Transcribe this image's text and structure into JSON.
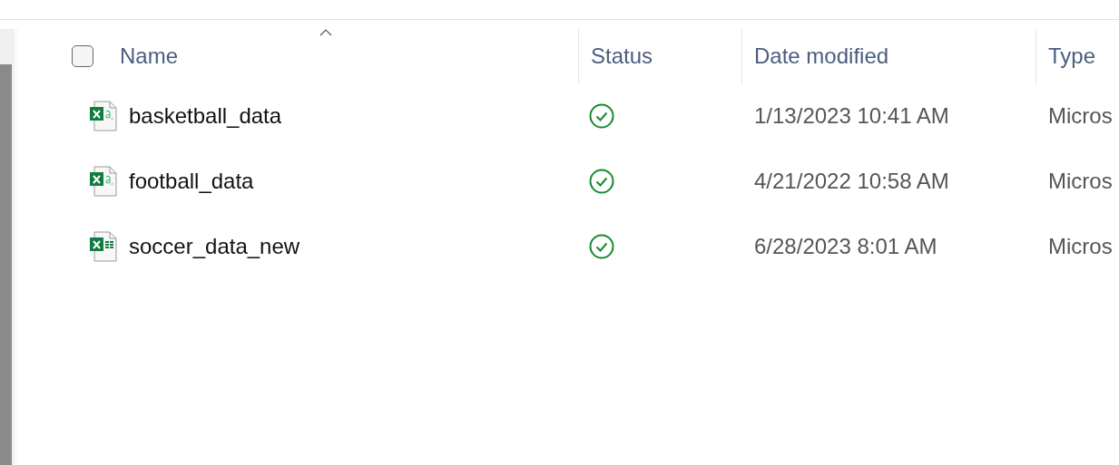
{
  "header": {
    "select_all": {
      "checked": false
    },
    "columns": [
      {
        "label": "Name",
        "sorted": true
      },
      {
        "label": "Status",
        "sorted": false
      },
      {
        "label": "Date modified",
        "sorted": false
      },
      {
        "label": "Type",
        "sorted": false
      }
    ]
  },
  "files": [
    {
      "name": "basketball_data",
      "kind": "csv",
      "synced": true,
      "date": "1/13/2023 10:41 AM",
      "type": "Micros"
    },
    {
      "name": "football_data",
      "kind": "csv",
      "synced": true,
      "date": "4/21/2022 10:58 AM",
      "type": "Micros"
    },
    {
      "name": "soccer_data_new",
      "kind": "xlsx",
      "synced": true,
      "date": "6/28/2023 8:01 AM",
      "type": "Micros"
    }
  ]
}
